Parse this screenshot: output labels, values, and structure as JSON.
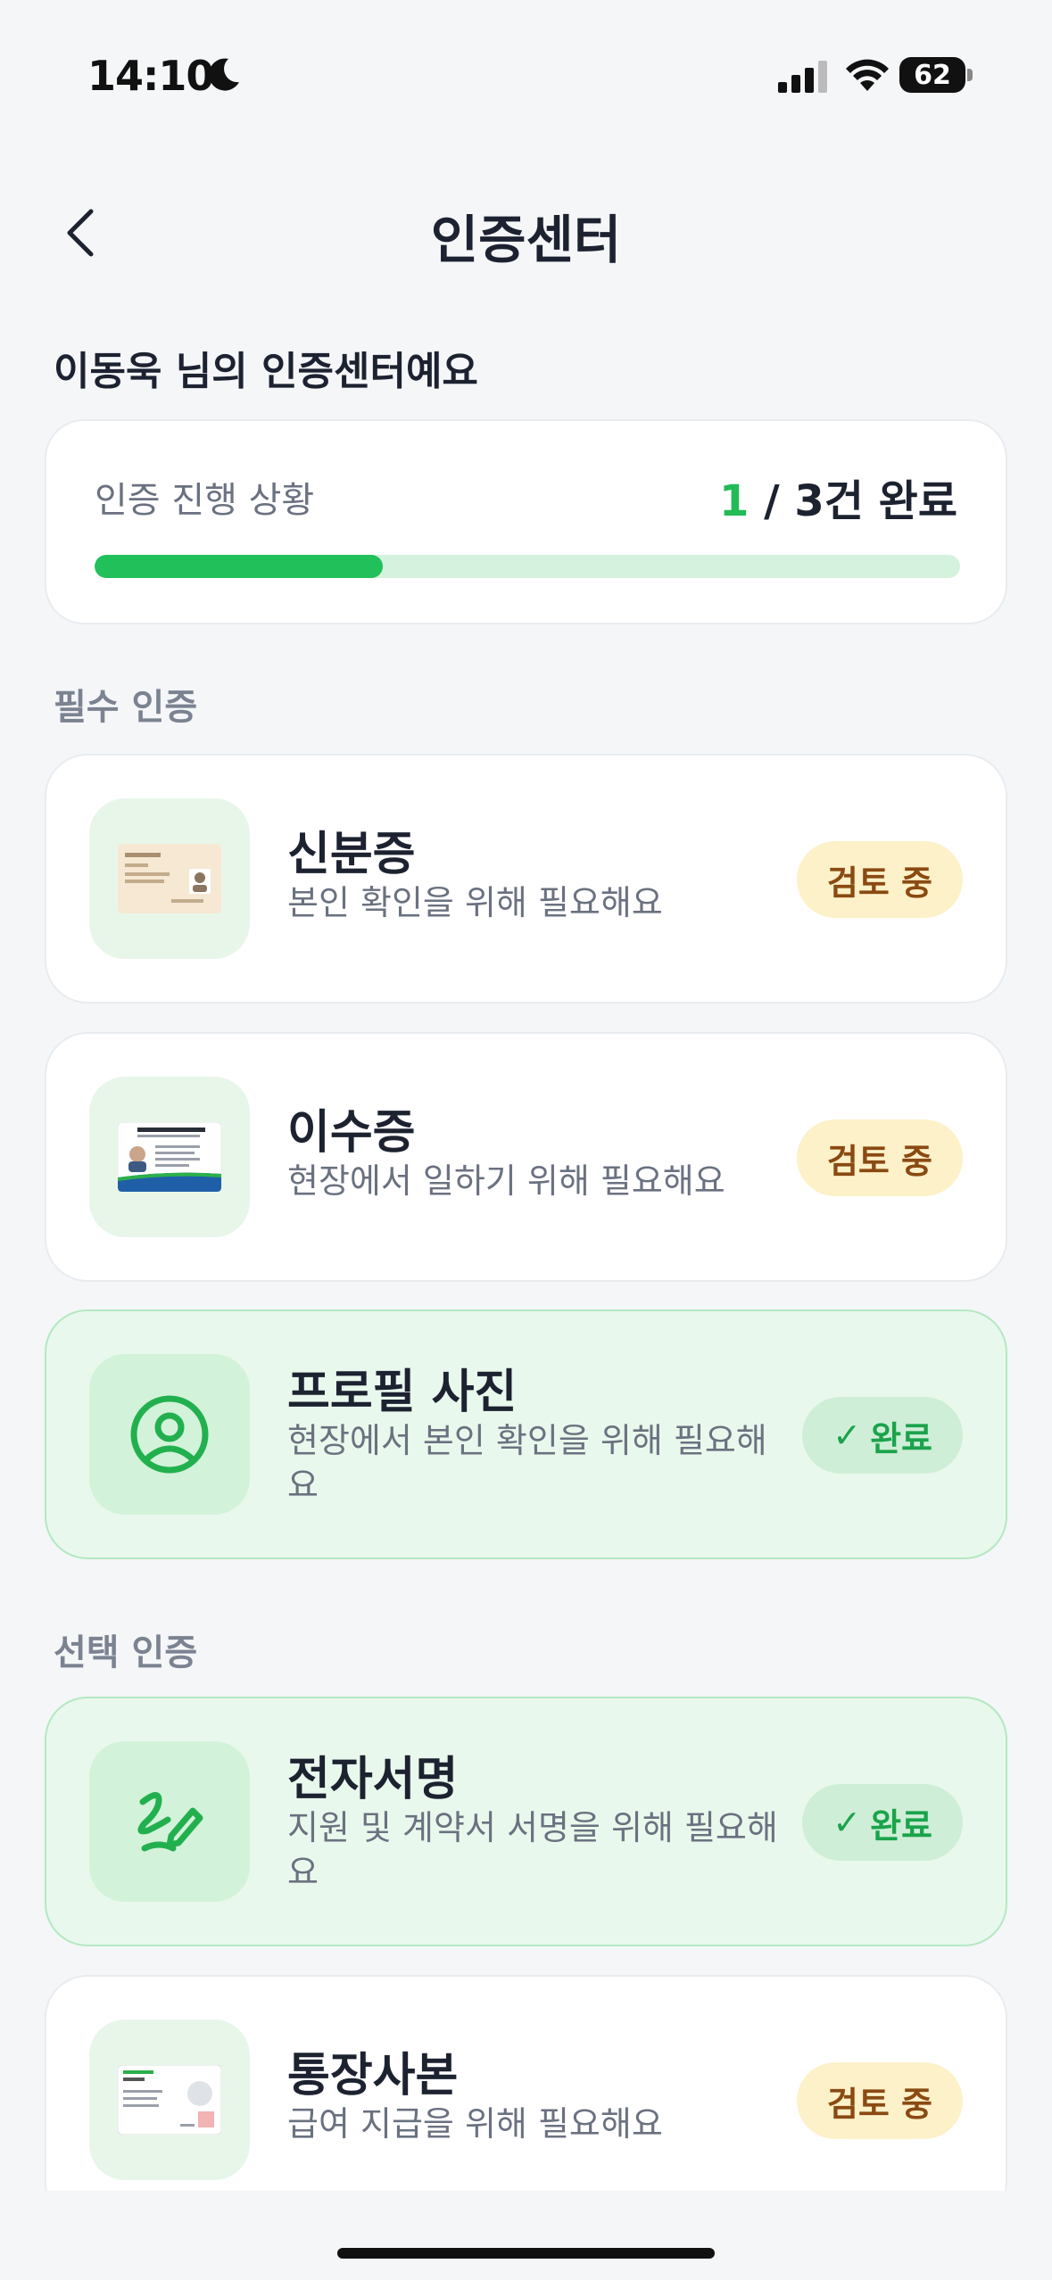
{
  "status_bar": {
    "time": "14:10",
    "battery": "62"
  },
  "header": {
    "title": "인증센터"
  },
  "greeting": "이동욱 님의 인증센터예요",
  "progress": {
    "label": "인증 진행 상황",
    "done": "1",
    "rest": " / 3건 완료",
    "fraction": 0.333
  },
  "sections": {
    "required": "필수 인증",
    "optional": "선택 인증"
  },
  "items": [
    {
      "title": "신분증",
      "desc": "본인 확인을 위해 필요해요",
      "status": "검토 중",
      "icon": "id-card-icon"
    },
    {
      "title": "이수증",
      "desc": "현장에서 일하기 위해 필요해요",
      "status": "검토 중",
      "icon": "certificate-icon"
    },
    {
      "title": "프로필 사진",
      "desc": "현장에서 본인 확인을 위해 필요해요",
      "status": "완료",
      "icon": "user-circle-icon"
    },
    {
      "title": "전자서명",
      "desc": "지원 및 계약서 서명을 위해 필요해요",
      "status": "완료",
      "icon": "signature-pen-icon"
    },
    {
      "title": "통장사본",
      "desc": "급여 지급을 위해 필요해요",
      "status": "검토 중",
      "icon": "bankbook-icon"
    }
  ],
  "colors": {
    "accent": "#22c05a",
    "review_bg": "#fdf1c9",
    "review_text": "#8a4a12",
    "done_bg": "#e9f8ec"
  }
}
